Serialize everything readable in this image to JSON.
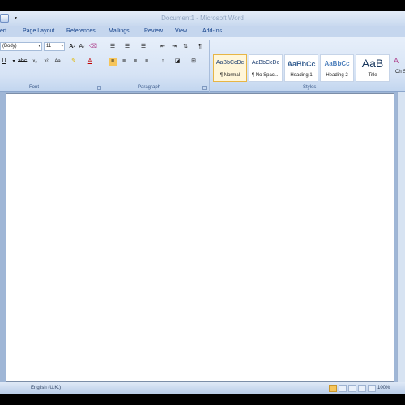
{
  "window": {
    "title": "Document1 - Microsoft Word"
  },
  "tabs": [
    "ert",
    "Page Layout",
    "References",
    "Mailings",
    "Review",
    "View",
    "Add-Ins"
  ],
  "font_group": {
    "font_name": "(Body)",
    "font_size": "11",
    "label": "Font"
  },
  "paragraph_group": {
    "label": "Paragraph"
  },
  "styles_group": {
    "label": "Styles",
    "items": [
      {
        "sample": "AaBbCcDc",
        "name": "¶ Normal"
      },
      {
        "sample": "AaBbCcDc",
        "name": "¶ No Spaci..."
      },
      {
        "sample": "AaBbCc",
        "name": "Heading 1"
      },
      {
        "sample": "AaBbCc",
        "name": "Heading 2"
      },
      {
        "sample": "AaB",
        "name": "Title"
      }
    ],
    "change_styles_partial": "Ch St"
  },
  "status": {
    "language": "English (U.K.)",
    "zoom": "100%"
  },
  "colors": {
    "accent": "#15428b",
    "selected_style": "#e7b545"
  }
}
